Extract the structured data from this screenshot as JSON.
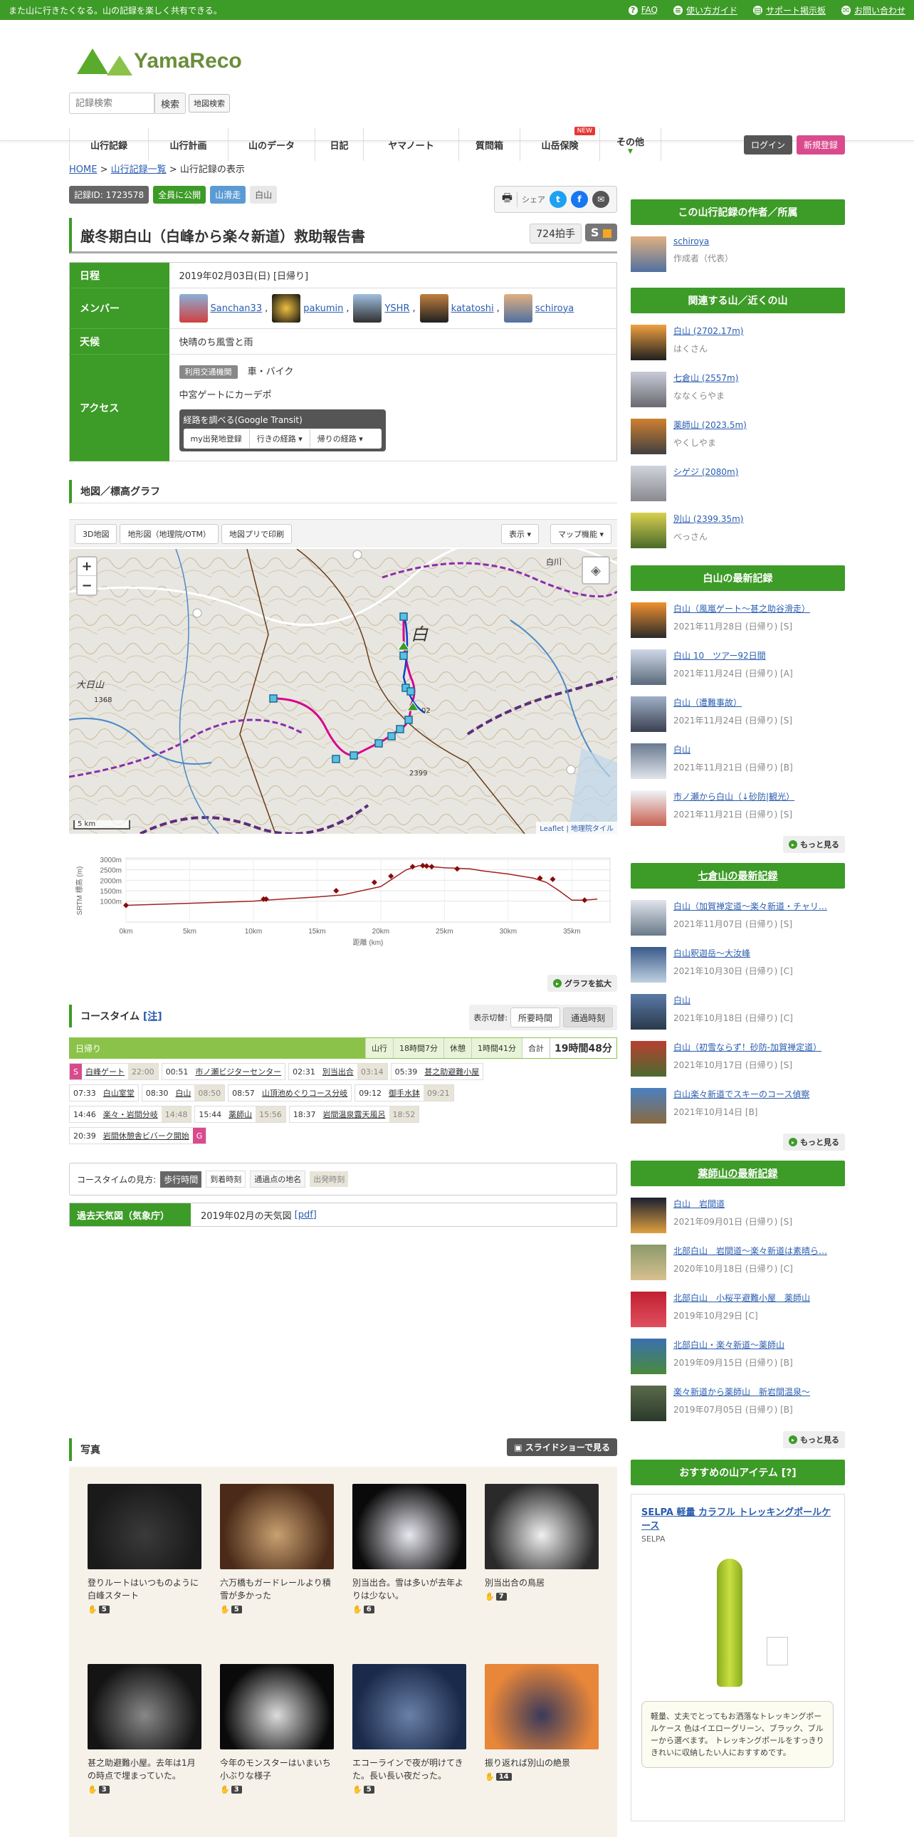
{
  "topbar": {
    "tagline": "また山に行きたくなる。山の記録を楽しく共有できる。",
    "faq": "FAQ",
    "guide": "使い方ガイド",
    "support": "サポート掲示板",
    "contact": "お問い合わせ"
  },
  "header": {
    "logo": "YamaReco",
    "search_placeholder": "記録検索",
    "search_btn": "検索",
    "map_search_btn": "地図検索",
    "nav": [
      "山行記録",
      "山行計画",
      "山のデータ",
      "日記",
      "ヤマノート",
      "質問箱",
      "山岳保険",
      "その他"
    ],
    "new_badge": "NEW",
    "login": "ログイン",
    "register": "新規登録"
  },
  "breadcrumb": {
    "home": "HOME",
    "list": "山行記録一覧",
    "current": "山行記録の表示"
  },
  "tags": {
    "record_id": "記録ID: 1723578",
    "public": "全員に公開",
    "ski": "山滑走",
    "area": "白山"
  },
  "share": {
    "label": "シェア"
  },
  "record": {
    "title": "厳冬期白山（白峰から楽々新道）救助報告書",
    "claps": "724拍手",
    "grade": "S"
  },
  "info": {
    "date_label": "日程",
    "date": "2019年02月03日(日) [日帰り]",
    "member_label": "メンバー",
    "members": [
      "Sanchan33",
      "pakumin",
      "YSHR",
      "katatoshi",
      "schiroya"
    ],
    "weather_label": "天候",
    "weather": "快晴のち風雪と雨",
    "access_label": "アクセス",
    "transit_label": "利用交通機関",
    "transit": "車・バイク",
    "access_note": "中宮ゲートにカーデポ",
    "route_title": "経路を調べる(Google Transit)",
    "route_btns": [
      "my出発地登録",
      "行きの経路 ▾",
      "帰りの経路 ▾"
    ]
  },
  "map": {
    "section": "地図／標高グラフ",
    "btn_3d": "3D地図",
    "btn_topo": "地形図（地理院/OTM）",
    "btn_print": "地図プリで印刷",
    "btn_show": "表示 ▾",
    "btn_func": "マップ機能 ▾",
    "zoom_in": "+",
    "zoom_out": "−",
    "scale": "5 km",
    "attribution": "Leaflet | 地理院タイル",
    "labels": {
      "shirakawa": "白川",
      "shiro": "白",
      "oshiroyama": "大日山",
      "h1368": "1368",
      "h2399": "2399",
      "h02": "02"
    }
  },
  "chart_data": {
    "type": "line",
    "ylabel": "SRTM 標高 (m)",
    "xlabel": "距離 (km)",
    "ylim": [
      0,
      3000
    ],
    "xlim": [
      0,
      38
    ],
    "yticks": [
      "3000m",
      "2500m",
      "2000m",
      "1500m",
      "1000m"
    ],
    "xticks": [
      "0km",
      "5km",
      "10km",
      "15km",
      "20km",
      "25km",
      "30km",
      "35km"
    ],
    "x": [
      0,
      5,
      10,
      11,
      15,
      17,
      20,
      21,
      22,
      23,
      24,
      25,
      27,
      28,
      30,
      32,
      33,
      34,
      35,
      36,
      37
    ],
    "y": [
      800,
      900,
      1000,
      1050,
      1200,
      1300,
      1700,
      2100,
      2500,
      2702,
      2650,
      2600,
      2550,
      2450,
      2300,
      2100,
      1900,
      1500,
      1050,
      1050,
      1100
    ],
    "markers": [
      {
        "x": 0,
        "y": 800
      },
      {
        "x": 10.8,
        "y": 1100
      },
      {
        "x": 11,
        "y": 1100
      },
      {
        "x": 16.5,
        "y": 1500
      },
      {
        "x": 19.5,
        "y": 1900
      },
      {
        "x": 20.8,
        "y": 2200
      },
      {
        "x": 22.5,
        "y": 2650
      },
      {
        "x": 23.3,
        "y": 2700
      },
      {
        "x": 23.6,
        "y": 2680
      },
      {
        "x": 24,
        "y": 2650
      },
      {
        "x": 26,
        "y": 2550
      },
      {
        "x": 32.5,
        "y": 2100
      },
      {
        "x": 33.5,
        "y": 2050
      },
      {
        "x": 36,
        "y": 1050
      }
    ]
  },
  "chart_btn": "グラフを拡大",
  "course": {
    "title": "コースタイム",
    "note": "[注]",
    "switch_label": "表示切替:",
    "switch_a": "所要時間",
    "switch_b": "通過時刻",
    "day": "日帰り",
    "walk_label": "山行",
    "walk": "18時間7分",
    "rest_label": "休憩",
    "rest": "1時間41分",
    "total_label": "合計",
    "total": "19時間48分",
    "rows": [
      [
        {
          "t": "",
          "n": "白峰ゲート",
          "b": "22:00",
          "s": "S"
        },
        {
          "t": "00:51",
          "n": "市ノ瀬ビジターセンター"
        },
        {
          "t": "02:31",
          "n": "別当出合",
          "b": "03:14"
        },
        {
          "t": "05:39",
          "n": "甚之助避難小屋"
        }
      ],
      [
        {
          "t": "07:33",
          "n": "白山室堂"
        },
        {
          "t": "08:30",
          "n": "白山",
          "b": "08:50"
        },
        {
          "t": "08:57",
          "n": "山頂池めぐりコース分岐"
        },
        {
          "t": "09:12",
          "n": "御手水鉢",
          "b": "09:21"
        }
      ],
      [
        {
          "t": "14:46",
          "n": "楽々・岩間分岐",
          "b": "14:48"
        },
        {
          "t": "15:44",
          "n": "薬師山",
          "b": "15:56"
        },
        {
          "t": "18:37",
          "n": "岩間温泉露天風呂",
          "b": "18:52"
        }
      ],
      [
        {
          "t": "20:39",
          "n": "岩間休憩舎ビバーク開始",
          "g": "G"
        }
      ]
    ],
    "legend_label": "コースタイムの見方:",
    "legend": [
      "歩行時間",
      "到着時刻",
      "通過点の地名",
      "出発時刻"
    ]
  },
  "weather_map": {
    "label": "過去天気図（気象庁）",
    "value": "2019年02月の天気図",
    "pdf": "[pdf]"
  },
  "photos": {
    "title": "写真",
    "slideshow": "スライドショーで見る",
    "items": [
      {
        "cap": "登りルートはいつものように白峰スタート",
        "n": "5",
        "c": [
          "#1a1a1a",
          "#3a3a3a"
        ]
      },
      {
        "cap": "六万橋もガードレールより積雪が多かった",
        "n": "5",
        "c": [
          "#4a2a18",
          "#c8a070"
        ]
      },
      {
        "cap": "別当出合。雪は多いが去年よりは少ない。",
        "n": "6",
        "c": [
          "#0a0a0a",
          "#e8e8f0"
        ]
      },
      {
        "cap": "別当出合の鳥居",
        "n": "7",
        "c": [
          "#2a2a2a",
          "#f0f0f0"
        ]
      },
      {
        "cap": "甚之助避難小屋。去年は1月の時点で埋まっていた。",
        "n": "3",
        "c": [
          "#141414",
          "#888"
        ]
      },
      {
        "cap": "今年のモンスターはいまいち小ぶりな様子",
        "n": "3",
        "c": [
          "#0a0a0a",
          "#dcdcdc"
        ]
      },
      {
        "cap": "エコーラインで夜が明けてきた。長い長い夜だった。",
        "n": "5",
        "c": [
          "#1a2a4a",
          "#6a80a8"
        ]
      },
      {
        "cap": "振り返れば別山の絶景",
        "n": "14",
        "c": [
          "#e8863a",
          "#3a3a5a"
        ]
      }
    ]
  },
  "sidebar": {
    "author_head": "この山行記録の作者／所属",
    "author": "schiroya",
    "author_role": "作成者（代表）",
    "mountains_head": "関連する山／近くの山",
    "mountains": [
      {
        "n": "白山 (2702.17m)",
        "y": "はくさん",
        "c": [
          "#f0a040",
          "#202020"
        ]
      },
      {
        "n": "七倉山 (2557m)",
        "y": "ななくらやま",
        "c": [
          "#c8ccd8",
          "#6a6a70"
        ]
      },
      {
        "n": "薬師山 (2023.5m)",
        "y": "やくしやま",
        "c": [
          "#d08030",
          "#404040"
        ]
      },
      {
        "n": "シゲジ (2080m)",
        "y": "",
        "c": [
          "#d0d4dc",
          "#8a8a90"
        ]
      },
      {
        "n": "別山 (2399.35m)",
        "y": "べっさん",
        "c": [
          "#d8d050",
          "#4a6a2a"
        ]
      }
    ],
    "hakusan_head": "白山の最新記録",
    "hakusan": [
      {
        "n": "白山（風嵐ゲート～甚之助谷滑走）",
        "d": "2021年11月28日 (日帰り) [S]",
        "c": [
          "#f09030",
          "#2a2a2a"
        ]
      },
      {
        "n": "白山 10　ツアー92日間",
        "d": "2021年11月24日 (日帰り) [A]",
        "c": [
          "#d0d8e8",
          "#5a6a7a"
        ]
      },
      {
        "n": "白山（遭難事故）",
        "d": "2021年11月24日 (日帰り) [S]",
        "c": [
          "#a0b0c8",
          "#3a4050"
        ]
      },
      {
        "n": "白山",
        "d": "2021年11月21日 (日帰り) [B]",
        "c": [
          "#6a7a90",
          "#e0e4ea"
        ]
      },
      {
        "n": "市ノ瀬から白山（↓砂防|観光）",
        "d": "2021年11月21日 (日帰り) [S]",
        "c": [
          "#f0f4f8",
          "#c86050"
        ]
      }
    ],
    "more": "もっと見る",
    "nanakura_head": "七倉山の最新記録",
    "nanakura": [
      {
        "n": "白山（加賀禅定道～楽々新道・チャリ…",
        "d": "2021年11月07日 (日帰り) [S]",
        "c": [
          "#e0e4ec",
          "#6a7a8a"
        ]
      },
      {
        "n": "白山釈迦岳～大汝峰",
        "d": "2021年10月30日 (日帰り) [C]",
        "c": [
          "#3a5a8a",
          "#c0d0e0"
        ]
      },
      {
        "n": "白山",
        "d": "2021年10月18日 (日帰り) [C]",
        "c": [
          "#5a7aa8",
          "#2a3a4a"
        ]
      },
      {
        "n": "白山（初雪ならず！砂防-加賀禅定道）",
        "d": "2021年10月17日 (日帰り) [S]",
        "c": [
          "#b84030",
          "#4a6a30"
        ]
      },
      {
        "n": "白山楽々新道でスキーのコース偵察",
        "d": "2021年10月14日 [B]",
        "c": [
          "#4a80c0",
          "#8a6a40"
        ]
      }
    ],
    "yakushi_head": "薬師山の最新記録",
    "yakushi": [
      {
        "n": "白山　岩間道",
        "d": "2021年09月01日 (日帰り) [S]",
        "c": [
          "#1a2030",
          "#e0a040"
        ]
      },
      {
        "n": "北部白山　岩間道～楽々新道は素晴ら…",
        "d": "2020年10月18日 (日帰り) [C]",
        "c": [
          "#8a9a6a",
          "#d8c090"
        ]
      },
      {
        "n": "北部白山　小桜平避難小屋　薬師山",
        "d": "2019年10月29日 [C]",
        "c": [
          "#c02030",
          "#e05060"
        ]
      },
      {
        "n": "北部白山・楽々新道～薬師山",
        "d": "2019年09月15日 (日帰り) [B]",
        "c": [
          "#3a70b0",
          "#4a8a3a"
        ]
      },
      {
        "n": "楽々新道から薬師山　新岩間温泉～",
        "d": "2019年07月05日 (日帰り) [B]",
        "c": [
          "#5a6a4a",
          "#2a3a2a"
        ]
      }
    ],
    "items_head": "おすすめの山アイテム [?]",
    "item_name": "SELPA 軽量 カラフル トレッキングポールケース",
    "item_brand": "SELPA",
    "item_desc": "軽量、丈夫でとってもお洒落なトレッキングポールケース 色はイエローグリーン、ブラック、ブルーから選べます。 トレッキングポールをすっきりきれいに収納したい人におすすめです。"
  },
  "colors": {
    "accent": "#3d9b27",
    "pink": "#d94b8d",
    "blue": "#5b9bd5"
  }
}
